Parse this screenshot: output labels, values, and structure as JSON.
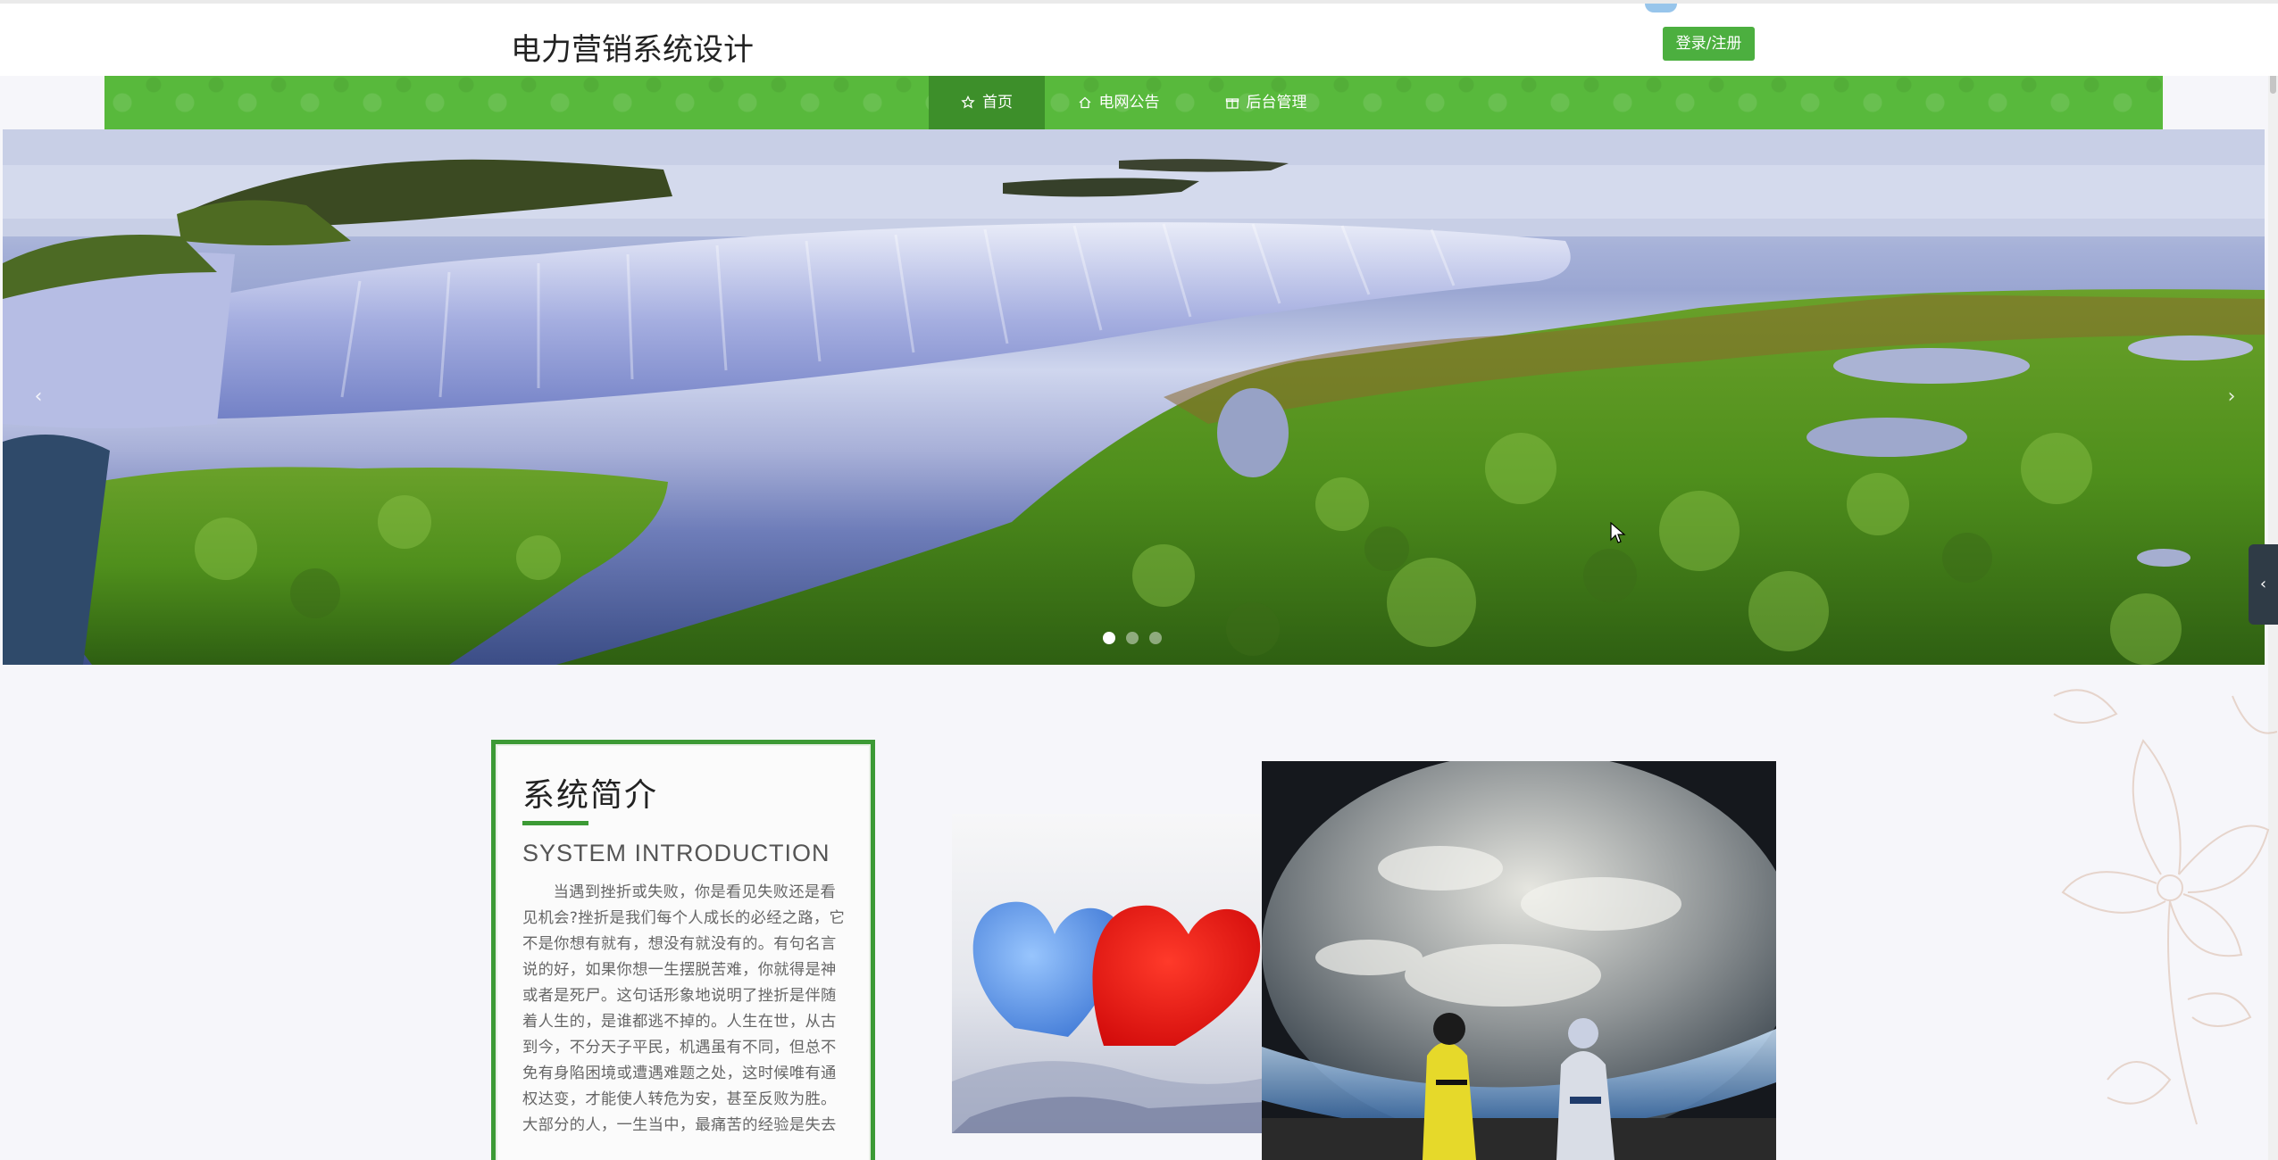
{
  "header": {
    "site_title": "电力营销系统设计",
    "login_label": "登录/注册"
  },
  "nav": {
    "items": [
      {
        "label": "首页",
        "icon": "star-icon",
        "active": true
      },
      {
        "label": "电网公告",
        "icon": "home-icon",
        "active": false
      },
      {
        "label": "后台管理",
        "icon": "gift-icon",
        "active": false
      }
    ]
  },
  "carousel": {
    "prev_arrow": "‹",
    "next_arrow": "›",
    "slide_count": 3,
    "active_slide": 1
  },
  "intro": {
    "title": "系统简介",
    "subtitle_en": "SYSTEM INTRODUCTION",
    "body": "当遇到挫折或失败，你是看见失败还是看见机会?挫折是我们每个人成长的必经之路，它不是你想有就有，想没有就没有的。有句名言说的好，如果你想一生摆脱苦难，你就得是神或者是死尸。这句话形象地说明了挫折是伴随着人生的，是谁都逃不掉的。人生在世，从古到今，不分天子平民，机遇虽有不同，但总不免有身陷困境或遭遇难题之处，这时候唯有通权达变，才能使人转危为安，甚至反败为胜。大部分的人，一生当中，最痛苦的经验是失去所爱的人，其次是丢掉一份工作。其实，经得起考验的人，就"
  },
  "colors": {
    "accent_green": "#4caf3f",
    "nav_green": "#58b93c",
    "nav_active": "#3d8f2a",
    "card_border": "#3c9a35"
  }
}
